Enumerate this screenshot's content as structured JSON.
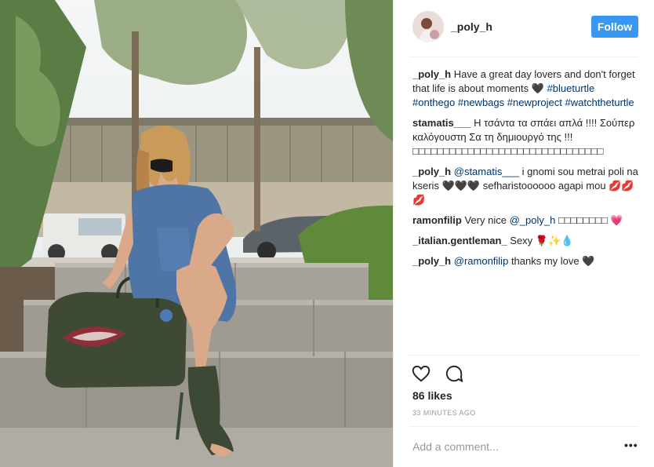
{
  "header": {
    "username": "_poly_h",
    "follow_label": "Follow"
  },
  "comments": [
    {
      "author": "_poly_h",
      "segments": [
        {
          "type": "text",
          "value": "Have a great day lovers and don't forget that life is about moments 🖤"
        },
        {
          "type": "link",
          "value": "#blueturtle"
        },
        {
          "type": "link",
          "value": "#onthego"
        },
        {
          "type": "link",
          "value": "#newbags"
        },
        {
          "type": "link",
          "value": "#newproject"
        },
        {
          "type": "link",
          "value": "#watchtheturtle"
        }
      ]
    },
    {
      "author": "stamatis___",
      "segments": [
        {
          "type": "text",
          "value": "Η τσάντα τα σπάει απλά !!!! Σούπερ καλόγουστη Σα τη δημιουργό της !!! □□□□□□□□□□□□□□□□□□□□□□□□□□□□□□□"
        }
      ]
    },
    {
      "author": "_poly_h",
      "segments": [
        {
          "type": "link",
          "value": "@stamatis___"
        },
        {
          "type": "text",
          "value": "i gnomi sou metrai poli na kseris 🖤🖤🖤 sefharistoooooo agapi mou 💋💋💋"
        }
      ]
    },
    {
      "author": "ramonfilip",
      "segments": [
        {
          "type": "text",
          "value": "Very nice"
        },
        {
          "type": "link",
          "value": "@_poly_h"
        },
        {
          "type": "text",
          "value": "□□□□□□□□ 💗"
        }
      ]
    },
    {
      "author": "_italian.gentleman_",
      "segments": [
        {
          "type": "text",
          "value": "Sexy 🌹✨💧"
        }
      ]
    },
    {
      "author": "_poly_h",
      "segments": [
        {
          "type": "link",
          "value": "@ramonfilip"
        },
        {
          "type": "text",
          "value": "thanks my love 🖤"
        }
      ]
    }
  ],
  "actions": {
    "like_icon": "heart-outline-icon",
    "comment_icon": "speech-bubble-icon"
  },
  "likes_text": "86 likes",
  "time_text": "33 MINUTES AGO",
  "add_comment": {
    "placeholder": "Add a comment..."
  },
  "more_label": "•••",
  "colors": {
    "follow_button": "#3897f0",
    "link": "#003569",
    "muted": "#999999",
    "text": "#262626"
  }
}
